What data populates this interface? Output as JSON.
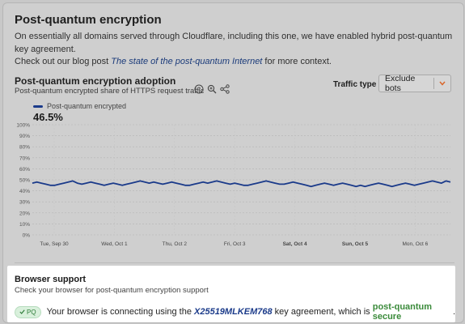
{
  "page": {
    "title": "Post-quantum encryption",
    "intro_text": "On essentially all domains served through Cloudflare, including this one, we have enabled hybrid post-quantum key agreement.",
    "blog_prefix": "Check out our blog post ",
    "blog_link": "The state of the post-quantum Internet",
    "blog_suffix": " for more context."
  },
  "adoption": {
    "title": "Post-quantum encryption adoption",
    "subtitle": "Post-quantum encrypted share of HTTPS request traffic",
    "icons": [
      "help-icon",
      "zoom-icon",
      "share-icon"
    ],
    "traffic_label": "Traffic type",
    "traffic_value": "Exclude bots",
    "current_value": "46.5%"
  },
  "chart_data": {
    "type": "line",
    "series": [
      {
        "name": "Post-quantum encrypted",
        "color": "#1a3a8a",
        "values": [
          47,
          48,
          47,
          46,
          45,
          45,
          46,
          47,
          48,
          49,
          47,
          46,
          47,
          48,
          47,
          46,
          45,
          46,
          47,
          46,
          45,
          46,
          47,
          48,
          49,
          48,
          47,
          48,
          47,
          46,
          47,
          48,
          47,
          46,
          45,
          45,
          46,
          47,
          48,
          47,
          48,
          49,
          48,
          47,
          46,
          47,
          46,
          45,
          45,
          46,
          47,
          48,
          49,
          48,
          47,
          46,
          46,
          47,
          48,
          47,
          46,
          45,
          44,
          45,
          46,
          47,
          46,
          45,
          46,
          47,
          46,
          45,
          44,
          45,
          44,
          45,
          46,
          47,
          46,
          45,
          44,
          45,
          46,
          47,
          46,
          45,
          46,
          47,
          48,
          49,
          48,
          47,
          49,
          48
        ]
      }
    ],
    "x_tick_labels": [
      "Tue, Sep 30",
      "Wed, Oct 1",
      "Thu, Oct 2",
      "Fri, Oct 3",
      "Sat, Oct 4",
      "Sun, Oct 5",
      "Mon, Oct 6"
    ],
    "x_tick_bold": [
      false,
      false,
      false,
      false,
      true,
      true,
      false
    ],
    "y_tick_labels": [
      "0%",
      "10%",
      "20%",
      "30%",
      "40%",
      "50%",
      "60%",
      "70%",
      "80%",
      "90%",
      "100%"
    ],
    "ylim": [
      0,
      100
    ],
    "grid": true,
    "legend": "top-left"
  },
  "browser_support": {
    "title": "Browser support",
    "subtitle": "Check your browser for post-quantum encryption support",
    "badge": "PQ",
    "text_prefix": "Your browser is connecting using the ",
    "key_agreement": "X25519MLKEM768",
    "text_middle": " key agreement, which is ",
    "status": "post-quantum secure",
    "text_suffix": "."
  }
}
